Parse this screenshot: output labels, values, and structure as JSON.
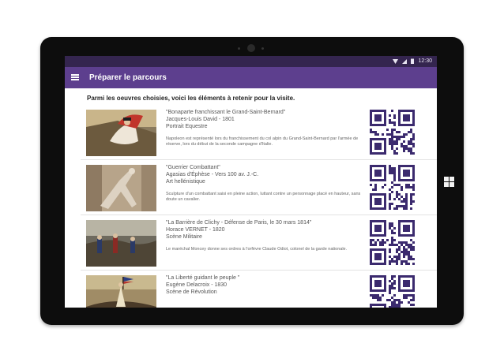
{
  "app": {
    "status_time": "12:30",
    "title": "Préparer le parcours",
    "intro": "Parmi les oeuvres choisies, voici les éléments à retenir pour la visite."
  },
  "colors": {
    "appbar": "#5d3f8e",
    "statusbar": "#34254f",
    "qr": "#3b2a6e"
  },
  "artworks": [
    {
      "title": "\"Bonaparte franchissant le Grand-Saint-Bernard\"",
      "artist": "Jacques-Louis David - 1801",
      "genre": "Portrait Equestre",
      "description": "Napoleon est représenté lors du franchissement du col alpin du Grand-Saint-Bernard par l'armée de réserve, lors du début de la seconde campagne d'Italie."
    },
    {
      "title": "\"Guerrier Combattant\"",
      "artist": "Agasias d'Éphèse - Vers 100 av. J.-C.",
      "genre": "Art hellénistique",
      "description": "Sculpture d'un combattant saisi en pleine action, luttant contre un personnage placé en hauteur, sans doute un cavalier."
    },
    {
      "title": "\"La Barrière de Clichy - Défense de Paris, le 30 mars 1814\"",
      "artist": "Horace VERNET  - 1820",
      "genre": "Scène Militaire",
      "description": "Le maréchal Moncey donne ses ordres à l'orfèvre Claude Odiot, colonel de la garde nationale."
    },
    {
      "title": "\"La Liberté guidant le peuple \"",
      "artist": "Eugène Delacroix - 1830",
      "genre": "Scène de Révolution",
      "description": ""
    }
  ]
}
